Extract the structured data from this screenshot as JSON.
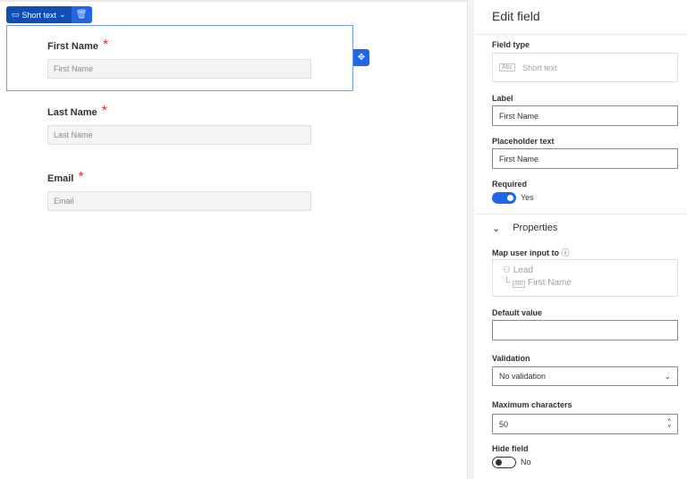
{
  "toolbar": {
    "type_label": "Short text",
    "delete_icon": "trash-icon",
    "move_icon": "move-icon"
  },
  "form": {
    "fields": [
      {
        "label": "First Name",
        "required": "*",
        "placeholder": "First Name"
      },
      {
        "label": "Last Name",
        "required": "*",
        "placeholder": "Last Name"
      },
      {
        "label": "Email",
        "required": "*",
        "placeholder": "Email"
      }
    ]
  },
  "panel": {
    "title": "Edit field",
    "field_type_label": "Field type",
    "field_type_value": "Short text",
    "label_label": "Label",
    "label_value": "First Name",
    "placeholder_label": "Placeholder text",
    "placeholder_value": "First Name",
    "required_label": "Required",
    "required_state": "Yes",
    "properties_label": "Properties",
    "map_label": "Map user input to",
    "map_entity": "Lead",
    "map_field": "First Name",
    "default_label": "Default value",
    "default_value": "",
    "validation_label": "Validation",
    "validation_value": "No validation",
    "maxchars_label": "Maximum characters",
    "maxchars_value": "50",
    "hide_label": "Hide field",
    "hide_state": "No"
  },
  "colors": {
    "accent": "#2266e3",
    "required": "#d13438"
  }
}
